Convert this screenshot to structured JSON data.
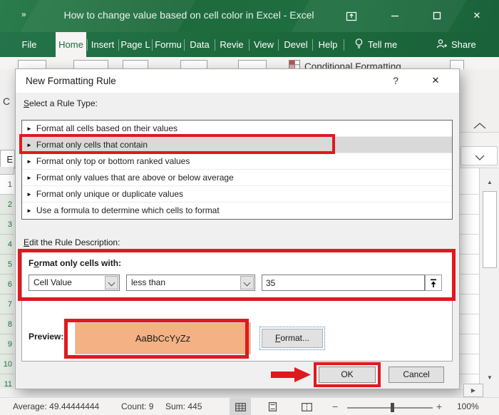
{
  "window": {
    "title": "How to change value based on cell color in Excel - Excel",
    "quick_access_icon": "»",
    "close_icon": "✕"
  },
  "ribbon": {
    "tabs": [
      "File",
      "Home",
      "Insert",
      "Page L",
      "Formu",
      "Data",
      "Revie",
      "View",
      "Devel",
      "Help"
    ],
    "active_tab": "Home",
    "tell_me_label": "Tell me",
    "share_label": "Share",
    "conditional_formatting_label": "Conditional Formatting"
  },
  "sheet": {
    "partial_ribbon_text": "C",
    "name_box_partial": "E",
    "row_numbers": [
      "1",
      "2",
      "3",
      "4",
      "5",
      "6",
      "7",
      "8",
      "9",
      "10",
      "11"
    ]
  },
  "dialog": {
    "title": "New Formatting Rule",
    "help_icon": "?",
    "close_icon": "✕",
    "select_rule_label": {
      "u": "S",
      "rest": "elect a Rule Type:"
    },
    "rule_types": [
      "Format all cells based on their values",
      "Format only cells that contain",
      "Format only top or bottom ranked values",
      "Format only values that are above or below average",
      "Format only unique or duplicate values",
      "Use a formula to determine which cells to format"
    ],
    "selected_rule": "Format only cells that contain",
    "edit_rule_label": {
      "u": "E",
      "rest": "dit the Rule Description:"
    },
    "format_cells_label": {
      "pre": "F",
      "u": "o",
      "rest": "rmat only cells with:"
    },
    "condition_field": "Cell Value",
    "condition_operator": "less than",
    "condition_value": "35",
    "preview_label": "Preview:",
    "preview_text": "AaBbCcYyZz",
    "format_button": {
      "u": "F",
      "rest": "ormat..."
    },
    "ok_label": "OK",
    "cancel_label": "Cancel"
  },
  "status_bar": {
    "average": "Average: 49.44444444",
    "count": "Count: 9",
    "sum": "Sum: 445",
    "zoom_out": "−",
    "zoom_in": "+",
    "zoom_level": "100%"
  },
  "colors": {
    "excel_green": "#1e6b3e",
    "annotation_red": "#e0191f",
    "preview_fill": "#f4b183",
    "selected_rule_bg": "#d9d9d9",
    "selected_row_header_bg": "#e2eae2"
  }
}
